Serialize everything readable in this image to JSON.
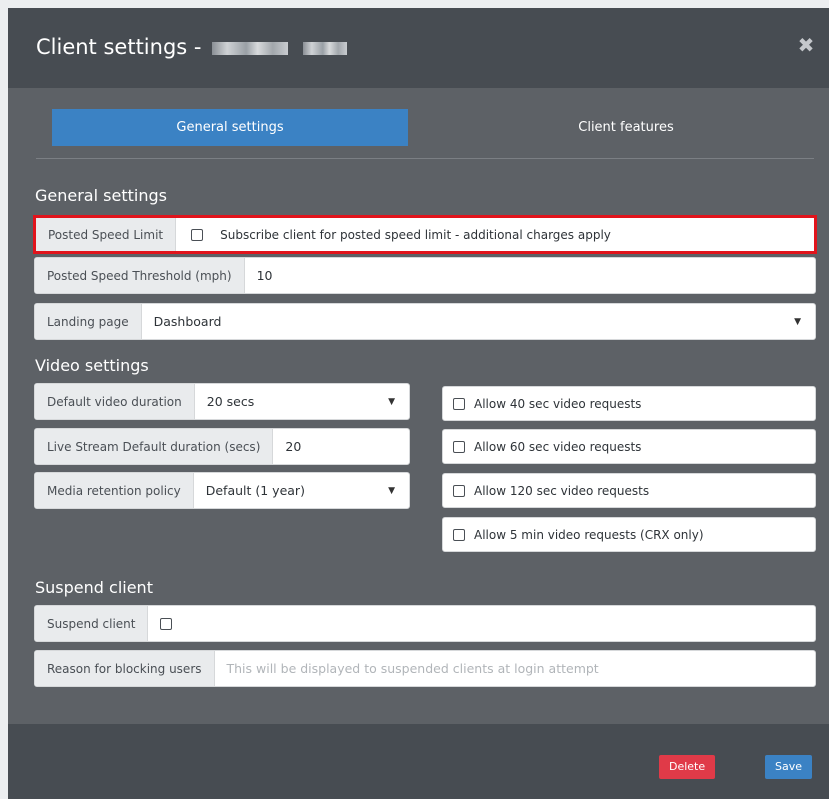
{
  "modal": {
    "title": "Client settings -",
    "close_icon": "close-icon"
  },
  "tabs": [
    {
      "label": "General settings",
      "active": true
    },
    {
      "label": "Client features",
      "active": false
    }
  ],
  "general": {
    "heading": "General settings",
    "posted_speed_limit": {
      "label": "Posted Speed Limit",
      "checkbox_label": "Subscribe client for posted speed limit - additional charges apply",
      "checked": false
    },
    "posted_speed_threshold": {
      "label": "Posted Speed Threshold (mph)",
      "value": "10"
    },
    "landing_page": {
      "label": "Landing page",
      "value": "Dashboard"
    }
  },
  "video": {
    "heading": "Video settings",
    "default_duration": {
      "label": "Default video duration",
      "value": "20 secs"
    },
    "live_stream": {
      "label": "Live Stream Default duration (secs)",
      "value": "20"
    },
    "media_retention": {
      "label": "Media retention policy",
      "value": "Default (1 year)"
    },
    "options": [
      {
        "label": "Allow 40 sec video requests",
        "checked": false
      },
      {
        "label": "Allow 60 sec video requests",
        "checked": false
      },
      {
        "label": "Allow 120 sec video requests",
        "checked": false
      },
      {
        "label": "Allow 5 min video requests (CRX only)",
        "checked": false
      }
    ]
  },
  "suspend": {
    "heading": "Suspend client",
    "suspend_client": {
      "label": "Suspend client",
      "checked": false
    },
    "reason": {
      "label": "Reason for blocking users",
      "placeholder": "This will be displayed to suspended clients at login attempt"
    }
  },
  "footer": {
    "delete_label": "Delete",
    "save_label": "Save"
  },
  "colors": {
    "primary": "#3b82c4",
    "danger": "#e03a48",
    "highlight_border": "#e1141c",
    "header_bg": "#474c52",
    "body_bg": "#5d6166"
  }
}
